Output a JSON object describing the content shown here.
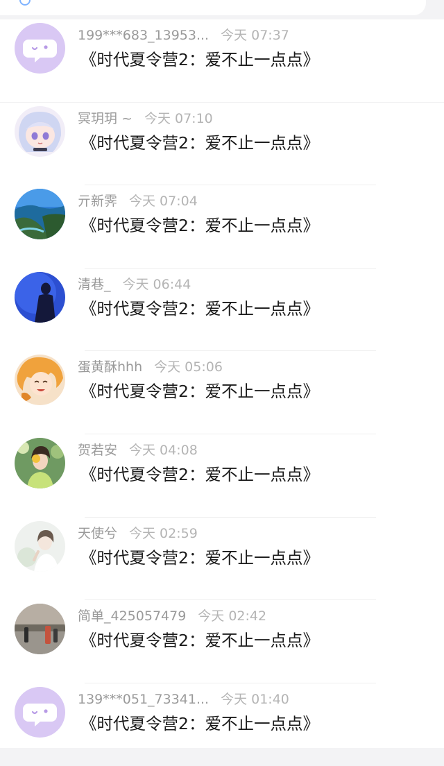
{
  "rows": [
    {
      "user": "199***683_13953...",
      "time": "今天 07:37",
      "message": "《时代夏令营2：爱不止一点点》",
      "avatar": "default-bot"
    },
    {
      "user": "冥玥玥 ~",
      "time": "今天 07:10",
      "message": "《时代夏令营2：爱不止一点点》",
      "avatar": "anime-girl"
    },
    {
      "user": "亓新霁",
      "time": "今天 07:04",
      "message": "《时代夏令营2：爱不止一点点》",
      "avatar": "seaside-landscape"
    },
    {
      "user": "清巷_",
      "time": "今天 06:44",
      "message": "《时代夏令营2：爱不止一点点》",
      "avatar": "blue-silhouette"
    },
    {
      "user": "蛋黄酥hhh",
      "time": "今天 05:06",
      "message": "《时代夏令营2：爱不止一点点》",
      "avatar": "anime-orange"
    },
    {
      "user": "贺若安",
      "time": "今天 04:08",
      "message": "《时代夏令营2：爱不止一点点》",
      "avatar": "girl-flowers"
    },
    {
      "user": "天使兮",
      "time": "今天 02:59",
      "message": "《时代夏令营2：爱不止一点点》",
      "avatar": "pale-portrait"
    },
    {
      "user": "简单_425057479",
      "time": "今天 02:42",
      "message": "《时代夏令营2：爱不止一点点》",
      "avatar": "street-photo"
    },
    {
      "user": "139***051_73341...",
      "time": "今天 01:40",
      "message": "《时代夏令营2：爱不止一点点》",
      "avatar": "default-bot"
    }
  ]
}
